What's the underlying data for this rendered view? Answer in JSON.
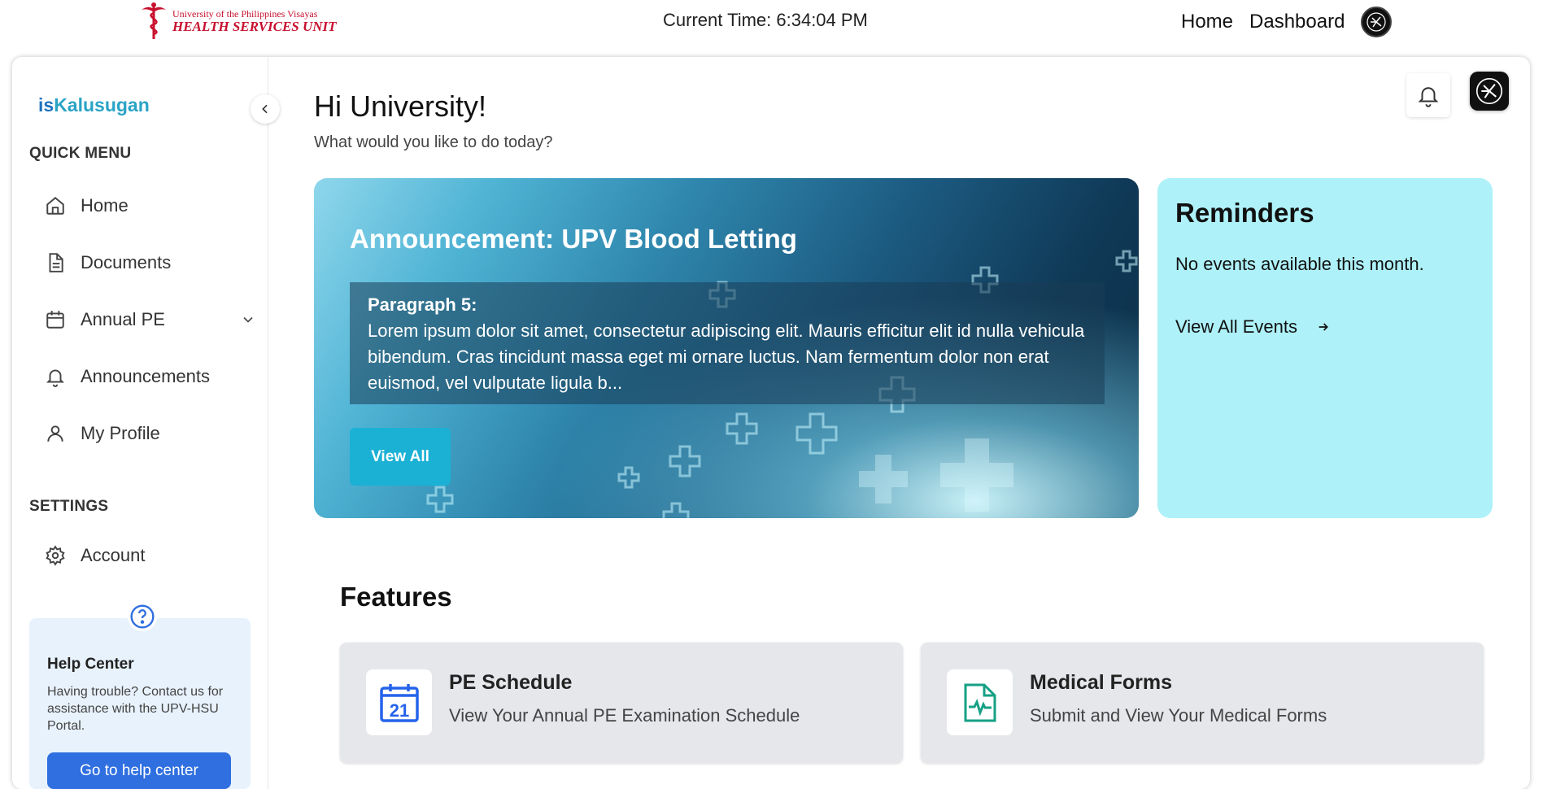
{
  "topbar": {
    "logo_line1": "University of the Philippines Visayas",
    "logo_line2": "HEALTH SERVICES UNIT",
    "current_time": "Current Time: 6:34:04 PM",
    "nav": [
      "Home",
      "Dashboard"
    ]
  },
  "sidebar": {
    "brand_prefix": "is",
    "brand_name": "Kalusugan",
    "quick_menu_title": "QUICK MENU",
    "items": [
      {
        "label": "Home",
        "icon": "home-icon"
      },
      {
        "label": "Documents",
        "icon": "document-icon"
      },
      {
        "label": "Annual PE",
        "icon": "calendar-icon"
      },
      {
        "label": "Announcements",
        "icon": "bell-icon"
      },
      {
        "label": "My Profile",
        "icon": "user-icon"
      }
    ],
    "settings_title": "SETTINGS",
    "settings_items": [
      {
        "label": "Account",
        "icon": "gear-icon"
      }
    ],
    "help": {
      "title": "Help Center",
      "text": "Having trouble? Contact us for assistance with the UPV-HSU Portal.",
      "button": "Go to help center"
    }
  },
  "main": {
    "greeting": "Hi University!",
    "subgreeting": "What would you like to do today?",
    "announcement": {
      "title": "Announcement: UPV Blood Letting",
      "paragraph_head": "Paragraph 5:",
      "paragraph_body": "Lorem ipsum dolor sit amet, consectetur adipiscing elit. Mauris efficitur elit id nulla vehicula bibendum. Cras tincidunt massa eget mi ornare luctus. Nam fermentum dolor non erat euismod, vel vulputate ligula b...",
      "button": "View All"
    },
    "reminders": {
      "title": "Reminders",
      "empty": "No events available this month.",
      "link": "View All Events"
    },
    "features_title": "Features",
    "features": [
      {
        "title": "PE Schedule",
        "desc": "View Your Annual PE Examination Schedule",
        "icon": "calendar-21-icon",
        "icon_number": "21"
      },
      {
        "title": "Medical Forms",
        "desc": "Submit and View Your Medical Forms",
        "icon": "medical-file-icon"
      }
    ]
  },
  "colors": {
    "brand_blue": "#1e73be",
    "brand_teal": "#2aa3c6",
    "reminders_bg": "#aef1f8",
    "view_all_btn": "#1ab1d4",
    "help_btn": "#2f6fe0",
    "logo_red": "#c8102e"
  }
}
